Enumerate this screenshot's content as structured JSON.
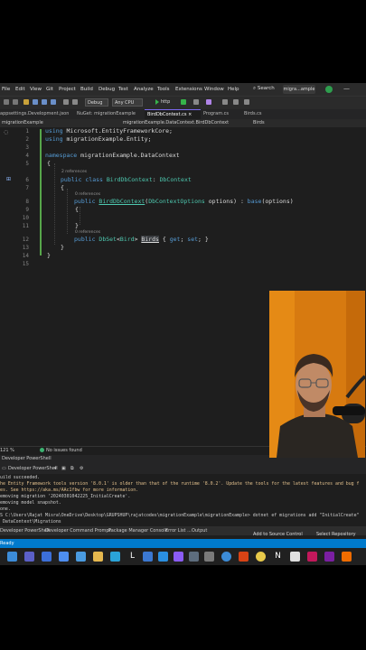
{
  "menu": {
    "items": [
      "File",
      "Edit",
      "View",
      "Git",
      "Project",
      "Build",
      "Debug",
      "Test",
      "Analyze",
      "Tools",
      "Extensions",
      "Window",
      "Help"
    ],
    "search_label": "Search",
    "window_title": "migra...ample"
  },
  "toolbar": {
    "config": "Debug",
    "platform": "Any CPU",
    "run_label": "http"
  },
  "tabs": [
    {
      "label": "appsettings.Development.json",
      "active": false
    },
    {
      "label": "NuGet: migrationExample",
      "active": false
    },
    {
      "label": "BirdDbContext.cs",
      "active": true
    },
    {
      "label": "Program.cs",
      "active": false
    },
    {
      "label": "Birds.cs",
      "active": false
    }
  ],
  "navbar": {
    "project": "migrationExample",
    "class_path": "migrationExample.DataContext.BirdDbContext",
    "member": "Birds"
  },
  "editor": {
    "lines": [
      "1",
      "2",
      "3",
      "4",
      "5",
      "6",
      "7",
      "8",
      "9",
      "10",
      "11",
      "12",
      "13",
      "14",
      "15"
    ],
    "refs": {
      "class_refs": "2 references",
      "ctor_refs": "0 references",
      "prop_refs": "0 references"
    },
    "code": {
      "l1_kw": "using",
      "l1_rest": " Microsoft.EntityFrameworkCore;",
      "l2_kw": "using",
      "l2_rest": " migrationExample.Entity;",
      "l4_kw": "namespace",
      "l4_rest": " migrationExample.DataContext",
      "l5": "{",
      "l6_kw": "public class ",
      "l6_ty": "BirdDbContext",
      "l6_p": ": ",
      "l6_base": "DbContext",
      "l7": "{",
      "l8_kw": "public ",
      "l8_name": "BirdDbContext",
      "l8_p": "(",
      "l8_ty": "DbContextOptions",
      "l8_rest": " options) : ",
      "l8_base": "base",
      "l8_end": "(options)",
      "l9": "{",
      "l11": "}",
      "l12_kw": "public ",
      "l12_ty": "DbSet",
      "l12_lt": "<",
      "l12_ty2": "Bird",
      "l12_gt": "> ",
      "l12_name": "Birds",
      "l12_rest": " { ",
      "l12_get": "get",
      "l12_s1": "; ",
      "l12_set": "set",
      "l12_s2": "; }",
      "l13": "}",
      "l14": "}"
    }
  },
  "statusrow": {
    "zoom": "121 %",
    "issues": "No issues found"
  },
  "terminal": {
    "title": "Developer PowerShell",
    "tab_label": "Developer PowerShell",
    "lines": [
      "uild succeeded.",
      "he Entity Framework tools version '8.0.1' is older than that of the runtime '8.0.2'. Update the tools for the latest features and bug f",
      "es. See https://aka.ms/AAc1fbw for more information.",
      "emoving migration '20240301042225_InitialCreate'.",
      "emoving model snapshot.",
      "one.",
      "S C:\\Users\\Rajat Misra\\OneDrive\\Desktop\\GRUPSHUP\\rajatcodes\\migrationExample\\migrationExample> dotnet ef migrations add \"InitialCreate\"",
      " DataContext\\Migrations"
    ]
  },
  "bottom_tabs": [
    "Developer PowerShell",
    "Developer Command Prompt",
    "Package Manager Console",
    "Error List ...",
    "Output"
  ],
  "vs_status": {
    "ready": "Ready",
    "source_control": "Add to Source Control",
    "repository": "Select Repository"
  },
  "taskbar": {
    "icons": [
      "edge-icon",
      "teams-icon",
      "explorer-icon",
      "store-icon",
      "edge2-icon",
      "l-icon",
      "mail-icon",
      "vscode-icon",
      "vs-icon",
      "photos-icon",
      "settings-icon",
      "app-icon",
      "app2-icon",
      "chrome-icon",
      "notion-icon",
      "app3-icon",
      "app4-icon",
      "postman-icon"
    ]
  },
  "colors": {
    "editor_bg": "#1e1e1e",
    "keyword": "#569cd6",
    "type": "#4ec9b0",
    "accent": "#007acc",
    "camera_bg": "#d77a10"
  }
}
